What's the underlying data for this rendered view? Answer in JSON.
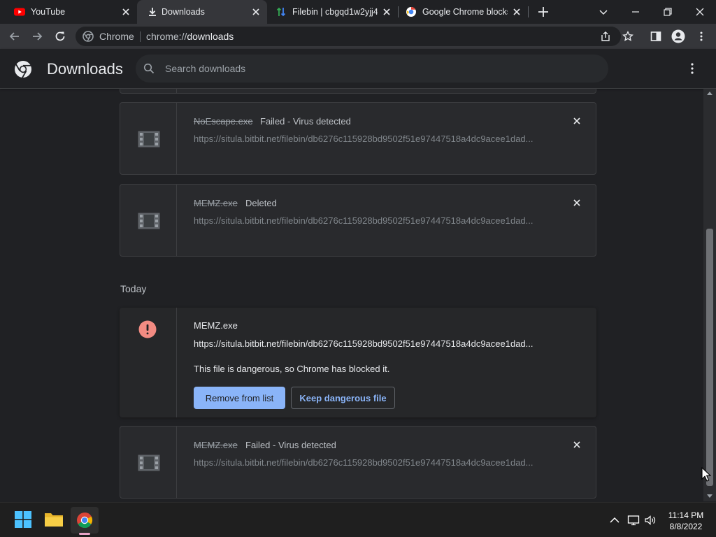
{
  "tabs": [
    {
      "title": "YouTube",
      "icon": "youtube-icon",
      "active": false
    },
    {
      "title": "Downloads",
      "icon": "download-icon",
      "active": true
    },
    {
      "title": "Filebin | cbgqd1w2yjj4",
      "icon": "filebin-icon",
      "active": false
    },
    {
      "title": "Google Chrome blocks",
      "icon": "google-icon",
      "active": false
    }
  ],
  "omnibox": {
    "chip": "Chrome",
    "scheme": "chrome://",
    "host": "downloads"
  },
  "header": {
    "title": "Downloads",
    "search_placeholder": "Search downloads"
  },
  "downloads": [
    {
      "name": "NoEscape.exe",
      "status": "Failed - Virus detected",
      "url": "https://situla.bitbit.net/filebin/db6276c115928bd9502f51e97447518a4dc9acee1dad..."
    },
    {
      "name": "MEMZ.exe",
      "status": "Deleted",
      "url": "https://situla.bitbit.net/filebin/db6276c115928bd9502f51e97447518a4dc9acee1dad..."
    }
  ],
  "today": {
    "label": "Today",
    "dangerous": {
      "name": "MEMZ.exe",
      "url": "https://situla.bitbit.net/filebin/db6276c115928bd9502f51e97447518a4dc9acee1dad...",
      "message": "This file is dangerous, so Chrome has blocked it.",
      "remove_label": "Remove from list",
      "keep_label": "Keep dangerous file"
    },
    "last": {
      "name": "MEMZ.exe",
      "status": "Failed - Virus detected",
      "url": "https://situla.bitbit.net/filebin/db6276c115928bd9502f51e97447518a4dc9acee1dad..."
    }
  },
  "clock": {
    "time": "11:14 PM",
    "date": "8/8/2022"
  },
  "colors": {
    "background": "#202124",
    "card": "#292a2d",
    "accent": "#8ab4f8",
    "danger": "#f28b82"
  }
}
